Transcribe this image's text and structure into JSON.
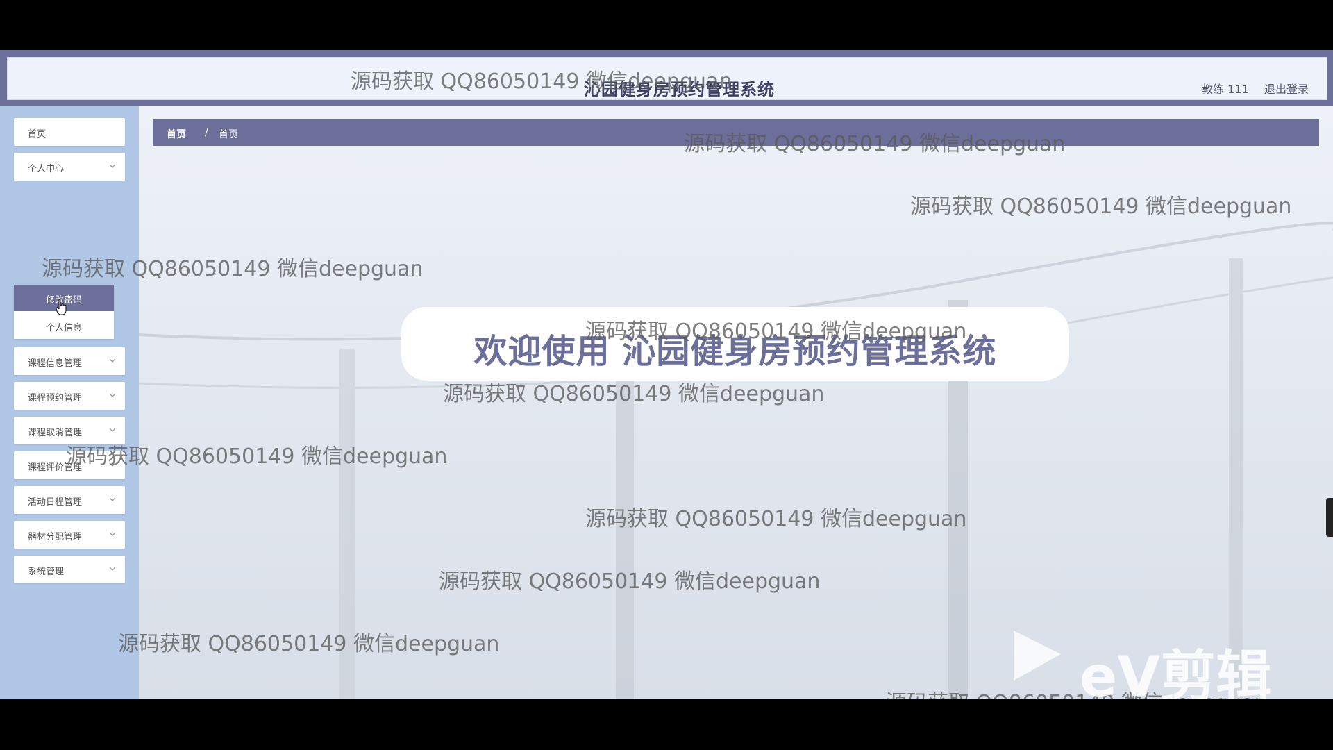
{
  "header": {
    "title": "沁园健身房预约管理系统",
    "user": "教练 111",
    "logout": "退出登录"
  },
  "sidebar": {
    "items": [
      {
        "label": "首页",
        "has_chevron": false
      },
      {
        "label": "个人中心",
        "has_chevron": true
      },
      {
        "label": "课程信息管理",
        "has_chevron": true
      },
      {
        "label": "课程预约管理",
        "has_chevron": true
      },
      {
        "label": "课程取消管理",
        "has_chevron": true
      },
      {
        "label": "课程评价管理",
        "has_chevron": true
      },
      {
        "label": "活动日程管理",
        "has_chevron": true
      },
      {
        "label": "器材分配管理",
        "has_chevron": true
      },
      {
        "label": "系统管理",
        "has_chevron": true
      }
    ],
    "submenu": [
      {
        "label": "修改密码",
        "active": true
      },
      {
        "label": "个人信息",
        "active": false
      }
    ]
  },
  "breadcrumb": {
    "home": "首页",
    "separator": "/",
    "current": "首页"
  },
  "welcome": "欢迎使用 沁园健身房预约管理系统",
  "watermark": "源码获取 QQ86050149 微信deepguan",
  "overlay": {
    "editor_logo": "eV剪辑"
  },
  "colors": {
    "accent": "#6c6f99",
    "sidebar_bg": "#b0c7e6",
    "header_bg": "#eef3fb"
  }
}
